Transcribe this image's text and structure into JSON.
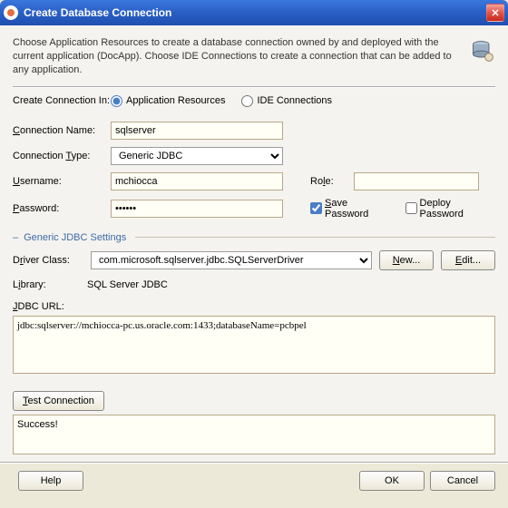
{
  "window": {
    "title": "Create Database Connection"
  },
  "intro": "Choose Application Resources to create a database connection owned by and deployed with the current application (DocApp). Choose IDE Connections to create a connection that can be added to any application.",
  "createIn": {
    "label": "Create Connection In:",
    "opt1": "Application Resources",
    "opt2": "IDE Connections"
  },
  "fields": {
    "connNameLabel": "Connection Name:",
    "connName": "sqlserver",
    "connTypeLabel": "Connection Type:",
    "connType": "Generic JDBC",
    "userLabel": "Username:",
    "user": "mchiocca",
    "roleLabel": "Role:",
    "role": "",
    "passLabel": "Password:",
    "pass": "••••••",
    "saveLabel": "Save Password",
    "deployLabel": "Deploy Password"
  },
  "jdbc": {
    "sectionTitle": "Generic JDBC Settings",
    "driverLabel": "Driver Class:",
    "driver": "com.microsoft.sqlserver.jdbc.SQLServerDriver",
    "newBtn": "New...",
    "editBtn": "Edit...",
    "libLabel": "Library:",
    "lib": "SQL Server JDBC",
    "urlLabel": "JDBC URL:",
    "url": "jdbc:sqlserver://mchiocca-pc.us.oracle.com:1433;databaseName=pcbpel"
  },
  "test": {
    "btn": "Test Connection",
    "result": "Success!"
  },
  "footer": {
    "help": "Help",
    "ok": "OK",
    "cancel": "Cancel"
  }
}
